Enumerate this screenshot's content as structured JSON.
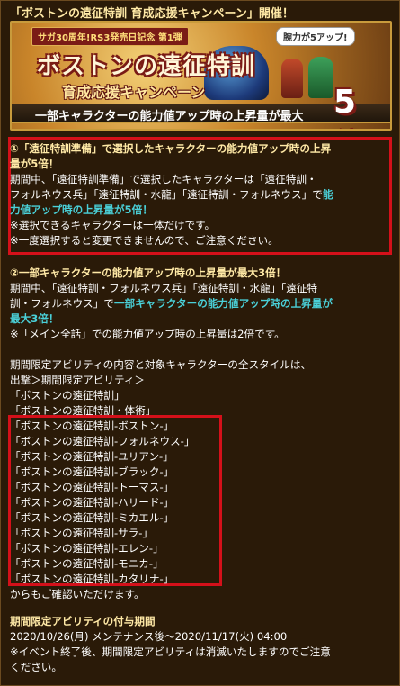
{
  "heading": "「ボストンの遠征特訓 育成応援キャンペーン」開催！",
  "banner": {
    "ribbon": "サガ30周年!RS3発売日記念 第1弾",
    "bubble": "腕力が5アップ!",
    "title": "ボストンの遠征特訓",
    "subtitle": "育成応援キャンペーン",
    "bar_text": "一部キャラクターの能力値アップ時の上昇量が最大",
    "big": "5倍!"
  },
  "section1": {
    "title_a": "①「遠征特訓準備」で選択したキャラクターの能力値アップ時の上昇",
    "title_b": "量が5倍！",
    "body_a": "期間中、「遠征特訓準備」で選択したキャラクターは「遠征特訓・",
    "body_b": "フォルネウス兵」「遠征特訓・水龍」「遠征特訓・フォルネウス」で",
    "hl_a": "能",
    "hl_b": "力値アップ時の上昇量が5倍！",
    "note1": "※選択できるキャラクターは一体だけです。",
    "note2": "※一度選択すると変更できませんので、ご注意ください。"
  },
  "section2": {
    "title": "②一部キャラクターの能力値アップ時の上昇量が最大3倍！",
    "body_a": "期間中、「遠征特訓・フォルネウス兵」「遠征特訓・水龍」「遠征特",
    "body_b": "訓・フォルネウス」で",
    "hl_b": "一部キャラクターの能力値アップ時の上昇量が",
    "hl_c": "最大3倍！",
    "note": "※「メイン全話」での能力値アップ時の上昇量は2倍です。"
  },
  "section3": {
    "intro1": "期間限定アビリティの内容と対象キャラクターの全スタイルは、",
    "intro2": "出撃＞期間限定アビリティ＞",
    "abilities": [
      "「ボストンの遠征特訓」",
      "「ボストンの遠征特訓・体術」",
      "「ボストンの遠征特訓-ボストン-」",
      "「ボストンの遠征特訓-フォルネウス-」",
      "「ボストンの遠征特訓-ユリアン-」",
      "「ボストンの遠征特訓-ブラック-」",
      "「ボストンの遠征特訓-トーマス-」",
      "「ボストンの遠征特訓-ハリード-」",
      "「ボストンの遠征特訓-ミカエル-」",
      "「ボストンの遠征特訓-サラ-」",
      "「ボストンの遠征特訓-エレン-」",
      "「ボストンの遠征特訓-モニカ-」",
      "「ボストンの遠征特訓-カタリナ-」"
    ],
    "outro": "からもご確認いただけます。"
  },
  "section4": {
    "title": "期間限定アビリティの付与期間",
    "period": "2020/10/26(月) メンテナンス後～2020/11/17(火) 04:00",
    "note_a": "※イベント終了後、期間限定アビリティは消滅いたしますのでご注意",
    "note_b": "ください。"
  }
}
